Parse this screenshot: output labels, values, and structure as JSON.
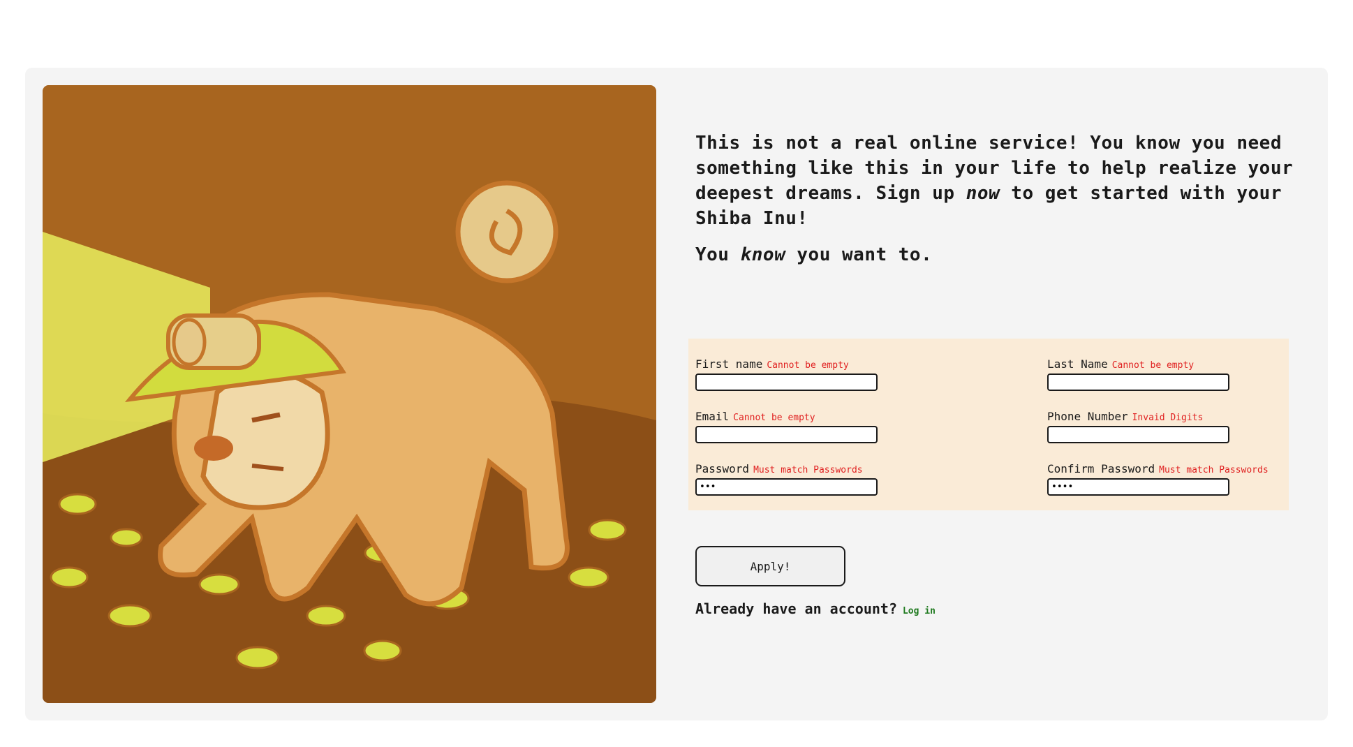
{
  "intro": {
    "p1_before": "This is not a real online service! You know you need something like this in your life to help realize your deepest dreams. Sign up ",
    "p1_emph": "now",
    "p1_after": " to get started with your Shiba Inu!",
    "p2_before": "You ",
    "p2_emph": "know",
    "p2_after": " you want to."
  },
  "form": {
    "first_name": {
      "label": "First name",
      "error": "Cannot be empty",
      "value": ""
    },
    "last_name": {
      "label": "Last Name",
      "error": "Cannot be empty",
      "value": ""
    },
    "email": {
      "label": "Email",
      "error": "Cannot be empty",
      "value": ""
    },
    "phone": {
      "label": "Phone Number",
      "error": "Invaid Digits",
      "value": ""
    },
    "password": {
      "label": "Password",
      "error": "Must match Passwords",
      "value": "•••"
    },
    "confirm_password": {
      "label": "Confirm Password",
      "error": "Must match Passwords",
      "value": "••••"
    }
  },
  "apply_label": "Apply!",
  "login": {
    "prompt": "Already have an account?",
    "link": "Log in"
  },
  "colors": {
    "accent_error": "#e02020",
    "link": "#1f7a1f",
    "panel": "#faebd7",
    "art_bg": "#a8651f"
  },
  "illustration": "shiba-inu-miner-with-headlamp"
}
